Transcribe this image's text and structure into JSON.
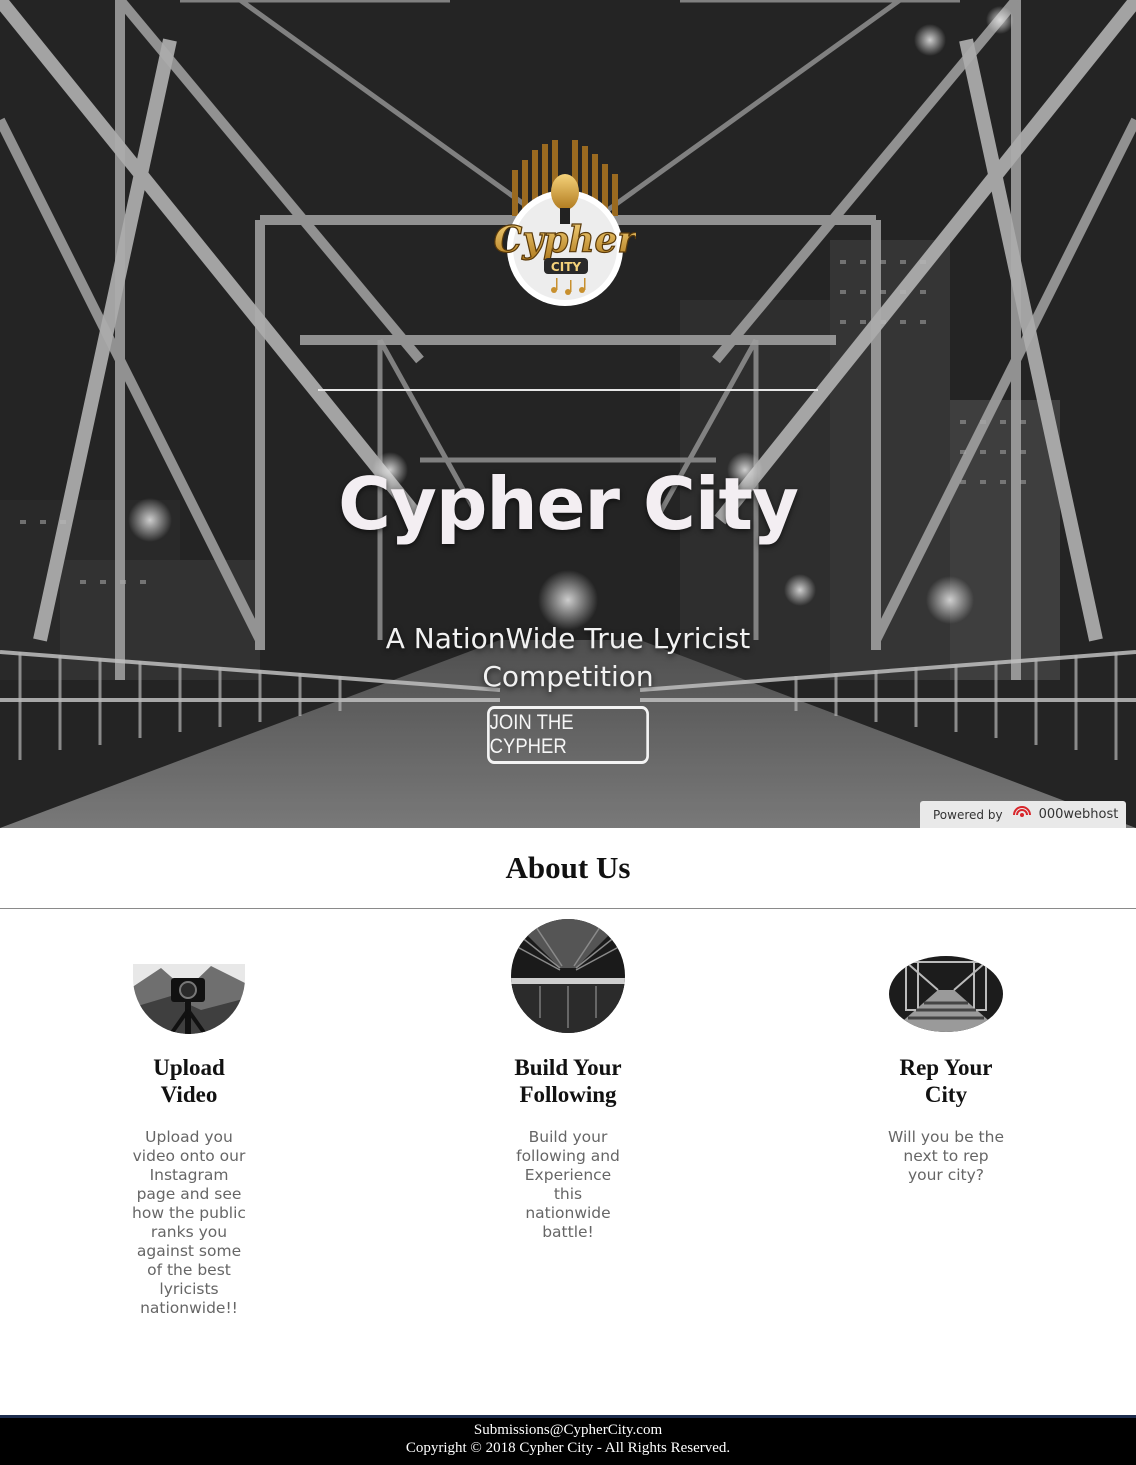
{
  "hero": {
    "logo_text": "Cypher",
    "logo_subtext": "CITY",
    "title": "Cypher City",
    "subtitle": "A NationWide True Lyricist Competition",
    "cta_label": "JOIN THE CYPHER"
  },
  "powered_badge": {
    "prefix": "Powered by",
    "brand": "000webhost",
    "icon": "webhost-logo-icon"
  },
  "about": {
    "heading": "About Us",
    "features": [
      {
        "title": "Upload Video",
        "text": "Upload you video onto our Instagram page and see how the public ranks you against some of the best lyricists nationwide!!",
        "image": "camera-tripod-photo"
      },
      {
        "title": "Build Your Following",
        "text": "Build your following and Experience this nationwide battle!",
        "image": "bridge-underside-photo"
      },
      {
        "title": "Rep Your City",
        "text": "Will you be the next to rep your city?",
        "image": "bridge-walkway-photo"
      }
    ]
  },
  "footer": {
    "email": "Submissions@CypherCity.com",
    "copyright": "Copyright © 2018 Cypher City - All Rights Reserved."
  },
  "colors": {
    "footer_bg": "#000000",
    "footer_border": "#1d2d4e",
    "logo_gold": "#d9a441"
  }
}
